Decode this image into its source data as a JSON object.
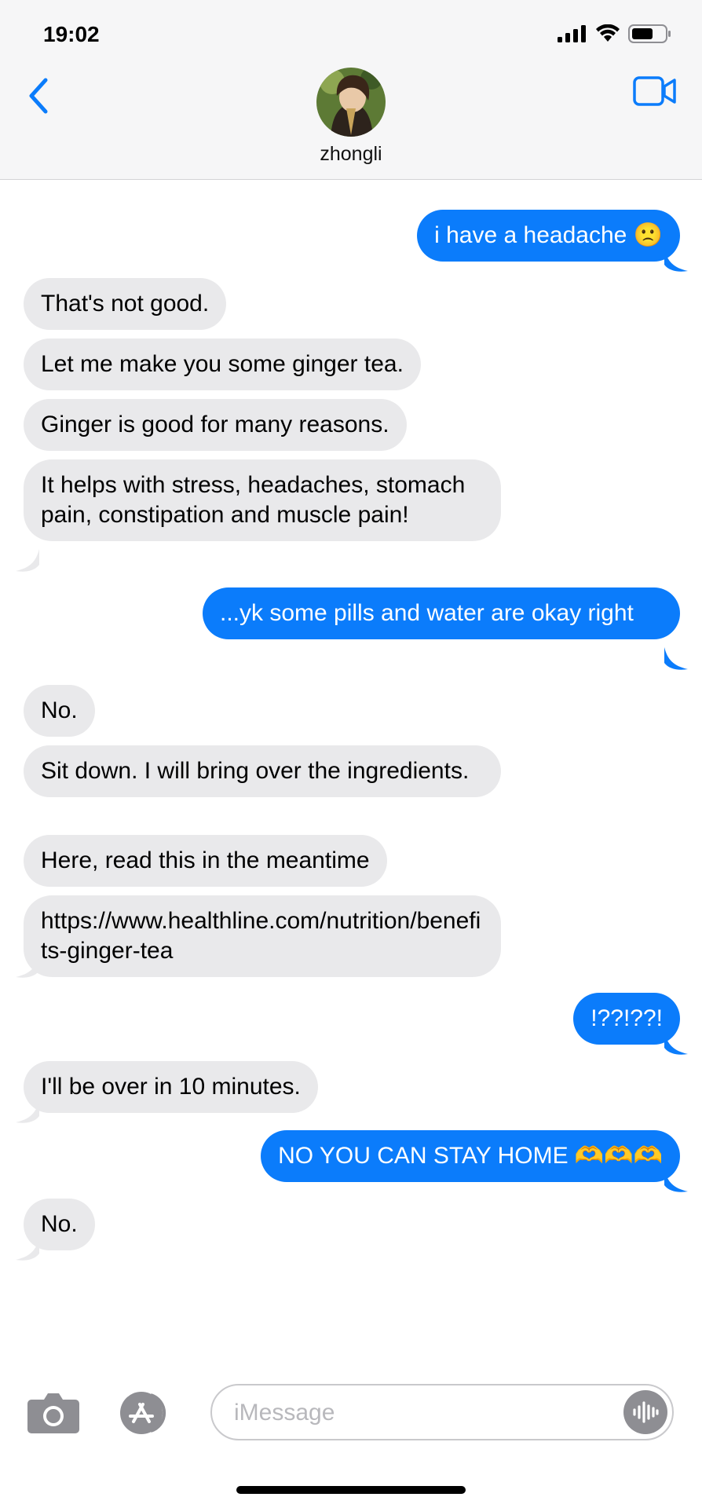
{
  "status_bar": {
    "time": "19:02"
  },
  "header": {
    "contact_name": "zhongli",
    "back_icon": "chevron-left-icon",
    "video_icon": "video-camera-icon",
    "accent_color": "#0b7cfb"
  },
  "messages": [
    {
      "from": "me",
      "text": "i have a headache 🙁"
    },
    {
      "from": "them",
      "text": "That's not good."
    },
    {
      "from": "them",
      "text": "Let me make you some ginger tea."
    },
    {
      "from": "them",
      "text": "Ginger is good for many reasons."
    },
    {
      "from": "them",
      "text": "It helps with stress, headaches, stomach pain, constipation and muscle pain!"
    },
    {
      "from": "me",
      "text": "...yk some pills and water are okay right"
    },
    {
      "from": "them",
      "text": "No."
    },
    {
      "from": "them",
      "text": "Sit down. I will bring over the ingredients."
    },
    {
      "from": "them",
      "text": "Here, read this in the meantime"
    },
    {
      "from": "them",
      "text": "https://www.healthline.com/nutrition/benefits-ginger-tea"
    },
    {
      "from": "me",
      "text": "!??!??!"
    },
    {
      "from": "them",
      "text": "I'll be over in 10 minutes."
    },
    {
      "from": "me",
      "text": "NO YOU CAN STAY HOME 🫶🫶🫶"
    },
    {
      "from": "them",
      "text": "No."
    }
  ],
  "composer": {
    "placeholder": "iMessage",
    "camera_icon": "camera-icon",
    "apps_icon": "app-store-icon",
    "audio_icon": "audio-waveform-icon"
  },
  "colors": {
    "outgoing_bubble": "#0b7cfb",
    "incoming_bubble": "#e9e9eb",
    "header_bg": "#f6f6f7"
  }
}
